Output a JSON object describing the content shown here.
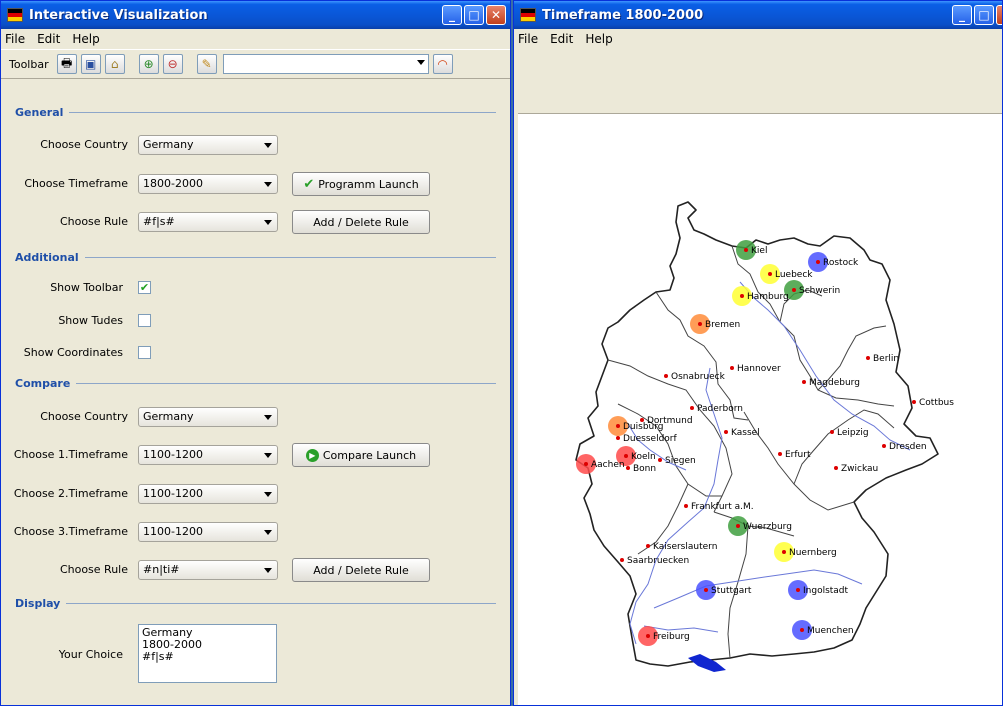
{
  "window1": {
    "title": "Interactive Visualization",
    "menu": [
      "File",
      "Edit",
      "Help"
    ],
    "toolbar": {
      "label": "Toolbar",
      "icons": [
        "printer-icon",
        "monitor-icon",
        "home-icon",
        "zoom-in-icon",
        "zoom-out-icon",
        "brush-icon"
      ],
      "combo_value": "",
      "trailing_icon": "rainbow-icon"
    },
    "general": {
      "title": "General",
      "country_label": "Choose Country",
      "country_value": "Germany",
      "timeframe_label": "Choose Timeframe",
      "timeframe_value": "1800-2000",
      "launch_button": "Programm Launch",
      "rule_label": "Choose Rule",
      "rule_value": "#f|s#",
      "rule_button": "Add / Delete Rule"
    },
    "additional": {
      "title": "Additional",
      "show_toolbar": "Show Toolbar",
      "show_toolbar_checked": true,
      "show_tudes": "Show Tudes",
      "show_tudes_checked": false,
      "show_coordinates": "Show Coordinates",
      "show_coordinates_checked": false
    },
    "compare": {
      "title": "Compare",
      "country_label": "Choose Country",
      "country_value": "Germany",
      "tf1_label": "Choose 1.Timeframe",
      "tf1_value": "1100-1200",
      "compare_button": "Compare Launch",
      "tf2_label": "Choose 2.Timeframe",
      "tf2_value": "1100-1200",
      "tf3_label": "Choose 3.Timeframe",
      "tf3_value": "1100-1200",
      "rule_label": "Choose Rule",
      "rule_value": "#n|ti#",
      "rule_button": "Add / Delete Rule"
    },
    "display": {
      "title": "Display",
      "choice_label": "Your Choice",
      "choice_lines": [
        "Germany",
        "1800-2000",
        "#f|s#"
      ]
    }
  },
  "window2": {
    "title": "Timeframe 1800-2000",
    "menu": [
      "File",
      "Edit",
      "Help"
    ],
    "cities": [
      {
        "name": "Kiel",
        "color": "#3f9f3f"
      },
      {
        "name": "Rostock",
        "color": "#4a52ff"
      },
      {
        "name": "Luebeck",
        "color": "#ffff33"
      },
      {
        "name": "Schwerin",
        "color": "#3f9f3f"
      },
      {
        "name": "Hamburg",
        "color": "#ffff33"
      },
      {
        "name": "Bremen",
        "color": "#ff8c3a"
      },
      {
        "name": "Berlin",
        "color": ""
      },
      {
        "name": "Osnabrueck",
        "color": ""
      },
      {
        "name": "Hannover",
        "color": ""
      },
      {
        "name": "Magdeburg",
        "color": ""
      },
      {
        "name": "Cottbus",
        "color": ""
      },
      {
        "name": "Paderborn",
        "color": ""
      },
      {
        "name": "Dortmund",
        "color": ""
      },
      {
        "name": "Duisburg",
        "color": "#ff8c3a"
      },
      {
        "name": "Duesseldorf",
        "color": ""
      },
      {
        "name": "Kassel",
        "color": ""
      },
      {
        "name": "Leipzig",
        "color": ""
      },
      {
        "name": "Dresden",
        "color": ""
      },
      {
        "name": "Koeln",
        "color": "#ff4a4a"
      },
      {
        "name": "Aachen",
        "color": "#ff4a4a"
      },
      {
        "name": "Bonn",
        "color": ""
      },
      {
        "name": "Siegen",
        "color": ""
      },
      {
        "name": "Erfurt",
        "color": ""
      },
      {
        "name": "Zwickau",
        "color": ""
      },
      {
        "name": "Frankfurt a.M.",
        "color": ""
      },
      {
        "name": "Wuerzburg",
        "color": "#3f9f3f"
      },
      {
        "name": "Kaiserslautern",
        "color": ""
      },
      {
        "name": "Nuernberg",
        "color": "#ffff33"
      },
      {
        "name": "Saarbruecken",
        "color": ""
      },
      {
        "name": "Stuttgart",
        "color": "#4a52ff"
      },
      {
        "name": "Ingolstadt",
        "color": "#4a52ff"
      },
      {
        "name": "Muenchen",
        "color": "#4a52ff"
      },
      {
        "name": "Freiburg",
        "color": "#ff4a4a"
      }
    ]
  },
  "colors": {
    "flag_black": "#000000",
    "flag_red": "#dd0000",
    "flag_gold": "#ffce00",
    "section_title": "#1f4fa8",
    "dot": "#dd0000"
  }
}
